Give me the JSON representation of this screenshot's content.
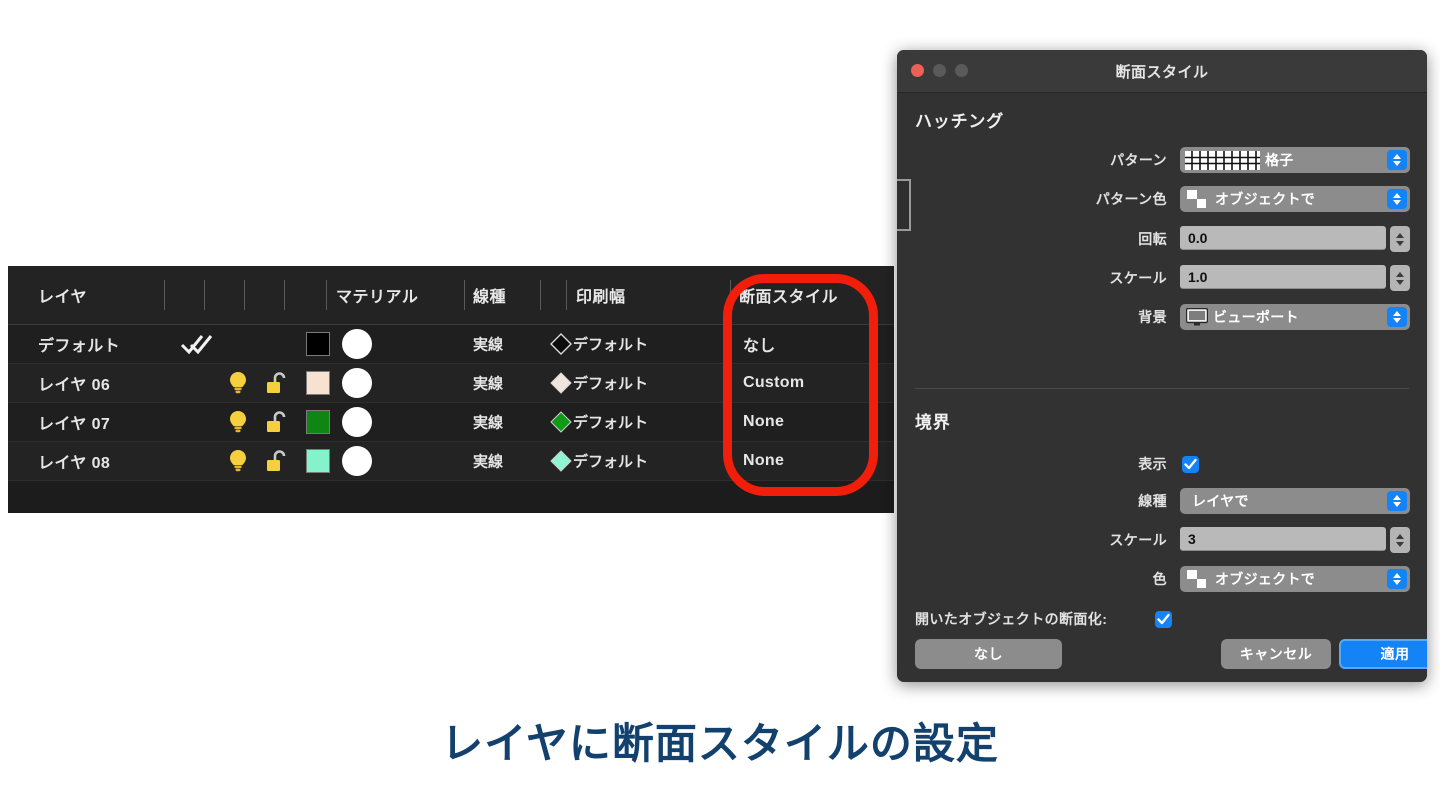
{
  "layer_panel": {
    "columns": [
      {
        "key": "layer",
        "label": "レイヤ"
      },
      {
        "key": "material",
        "label": "マテリアル"
      },
      {
        "key": "linetype",
        "label": "線種"
      },
      {
        "key": "printwidth",
        "label": "印刷幅"
      },
      {
        "key": "sectionstyle",
        "label": "断面スタイル"
      }
    ],
    "rows": [
      {
        "name": "デフォルト",
        "visible_icon": "check-icon",
        "bulb_icon": "",
        "lock_icon": "",
        "swatch_color": "#000000",
        "material_circle": "#ffffff",
        "linetype": "実線",
        "linewidth_swatch": "#0d0d0d",
        "linewidth": "デフォルト",
        "section_style": "なし"
      },
      {
        "name": "レイヤ 06",
        "visible_icon": "lightbulb-icon",
        "bulb_icon": "lightbulb-icon",
        "lock_icon": "unlock-icon",
        "swatch_color": "#f7e2d2",
        "material_circle": "#ffffff",
        "linetype": "実線",
        "linewidth_swatch": "#f2e6dc",
        "linewidth": "デフォルト",
        "section_style": "Custom"
      },
      {
        "name": "レイヤ 07",
        "visible_icon": "lightbulb-icon",
        "bulb_icon": "lightbulb-icon",
        "lock_icon": "unlock-icon",
        "swatch_color": "#0f8514",
        "material_circle": "#ffffff",
        "linetype": "実線",
        "linewidth_swatch": "#0f9a18",
        "linewidth": "デフォルト",
        "section_style": "None"
      },
      {
        "name": "レイヤ 08",
        "visible_icon": "lightbulb-icon",
        "bulb_icon": "lightbulb-icon",
        "lock_icon": "unlock-icon",
        "swatch_color": "#84f3cb",
        "material_circle": "#ffffff",
        "linetype": "実線",
        "linewidth_swatch": "#8ef5d0",
        "linewidth": "デフォルト",
        "section_style": "None"
      }
    ],
    "highlight_color": "#f01e0a"
  },
  "dialog": {
    "title": "断面スタイル",
    "hatching": {
      "section_label": "ハッチング",
      "pattern_label": "パターン",
      "pattern_value": "格子",
      "pattern_icon": "grid-pattern-icon",
      "pattern_color_label": "パターン色",
      "pattern_color_value": "オブジェクトで",
      "pattern_color_icon": "object-color-icon",
      "rotation_label": "回転",
      "rotation_value": "0.0",
      "scale_label": "スケール",
      "scale_value": "1.0",
      "background_label": "背景",
      "background_value": "ビューポート",
      "background_icon": "monitor-icon"
    },
    "border": {
      "section_label": "境界",
      "show_label": "表示",
      "show_checked": true,
      "linetype_label": "線種",
      "linetype_value": "レイヤで",
      "scale_label": "スケール",
      "scale_value": "3",
      "color_label": "色",
      "color_value": "オブジェクトで",
      "color_icon": "object-color-icon"
    },
    "open_object_label": "開いたオブジェクトの断面化:",
    "open_object_checked": true,
    "buttons": {
      "none": "なし",
      "cancel": "キャンセル",
      "apply": "適用"
    },
    "accent_color": "#1383f5"
  },
  "caption": {
    "text": "レイヤに断面スタイルの設定",
    "color": "#12416e"
  }
}
